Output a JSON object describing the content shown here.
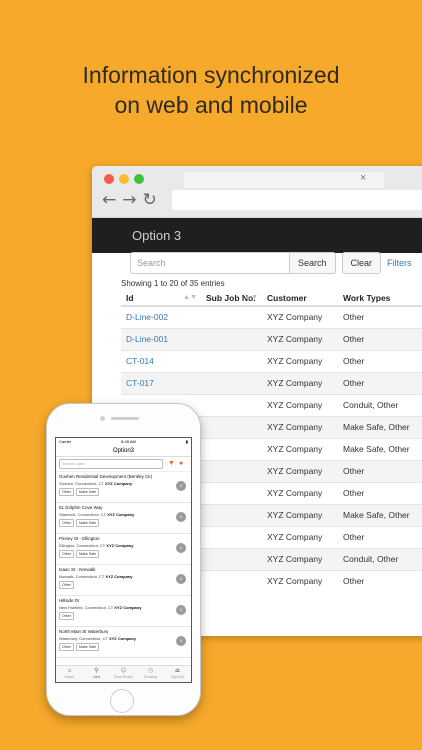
{
  "headline": {
    "line1": "Information synchronized",
    "line2": "on web and mobile"
  },
  "colors": {
    "background": "#F6A92A",
    "link": "#337ab7",
    "accent_orange": "#e8692a"
  },
  "browser": {
    "tab_close": "×",
    "nav": {
      "back": "←",
      "forward": "→",
      "reload": "↻"
    },
    "header_title": "Option 3",
    "search_placeholder": "Search",
    "search_button": "Search",
    "clear_button": "Clear",
    "filters_link": "Filters",
    "showing": "Showing 1 to 20 of 35 entries",
    "columns": [
      "Id",
      "Sub Job No.",
      "Customer",
      "Work Types"
    ],
    "rows": [
      {
        "id": "D-Line-002",
        "sub": "",
        "customer": "XYZ Company",
        "work": "Other"
      },
      {
        "id": "D-Line-001",
        "sub": "",
        "customer": "XYZ Company",
        "work": "Other"
      },
      {
        "id": "CT-014",
        "sub": "",
        "customer": "XYZ Company",
        "work": "Other"
      },
      {
        "id": "CT-017",
        "sub": "",
        "customer": "XYZ Company",
        "work": "Other"
      },
      {
        "id": "",
        "sub": "",
        "customer": "XYZ Company",
        "work": "Conduit, Other"
      },
      {
        "id": "",
        "sub": "",
        "customer": "XYZ Company",
        "work": "Make Safe, Other"
      },
      {
        "id": "",
        "sub": "",
        "customer": "XYZ Company",
        "work": "Make Safe, Other"
      },
      {
        "id": "",
        "sub": "",
        "customer": "XYZ Company",
        "work": "Other"
      },
      {
        "id": "",
        "sub": "",
        "customer": "XYZ Company",
        "work": "Other"
      },
      {
        "id": "",
        "sub": "",
        "customer": "XYZ Company",
        "work": "Make Safe, Other"
      },
      {
        "id": "",
        "sub": "",
        "customer": "XYZ Company",
        "work": "Other"
      },
      {
        "id": "",
        "sub": "",
        "customer": "XYZ Company",
        "work": "Conduit, Other"
      },
      {
        "id": "",
        "sub": "",
        "customer": "XYZ Company",
        "work": "Other"
      }
    ]
  },
  "phone": {
    "status": {
      "carrier": "Carrier",
      "time": "8:45 AM",
      "battery": "▮"
    },
    "title": "Option3",
    "search_placeholder": "Search Jobs",
    "jobs": [
      {
        "name": "Goshen Residential Development (Bentley Cir)",
        "addr": "Goshen, Connecticut, CT",
        "customer": "XYZ Company",
        "tags": [
          "Other",
          "Make Safe"
        ]
      },
      {
        "name": "51 Dolphin Cove Way",
        "addr": "Stamford, Connecticut, CT",
        "customer": "XYZ Company",
        "tags": [
          "Other",
          "Make Safe"
        ]
      },
      {
        "name": "Pinney St - Ellington",
        "addr": "Ellington, Connecticut, CT",
        "customer": "XYZ Company",
        "tags": [
          "Other",
          "Make Safe"
        ]
      },
      {
        "name": "Isaac St - Norwalk",
        "addr": "Norwalk, Connecticut, CT",
        "customer": "XYZ Company",
        "tags": [
          "Other"
        ]
      },
      {
        "name": "Hillside Dr",
        "addr": "New Fairfield, Connecticut, CT",
        "customer": "XYZ Company",
        "tags": [
          "Other"
        ]
      },
      {
        "name": "North Main St Waterbury",
        "addr": "Waterbury, Connecticut, CT",
        "customer": "XYZ Company",
        "tags": [
          "Other",
          "Make Safe"
        ]
      }
    ],
    "tabs": [
      {
        "icon": "⌂",
        "label": "Home"
      },
      {
        "icon": "⚲",
        "label": "Jobs"
      },
      {
        "icon": "☺",
        "label": "Crew Roster"
      },
      {
        "icon": "◷",
        "label": "Clocking"
      },
      {
        "icon": "⏏",
        "label": "Sign Out"
      }
    ]
  }
}
